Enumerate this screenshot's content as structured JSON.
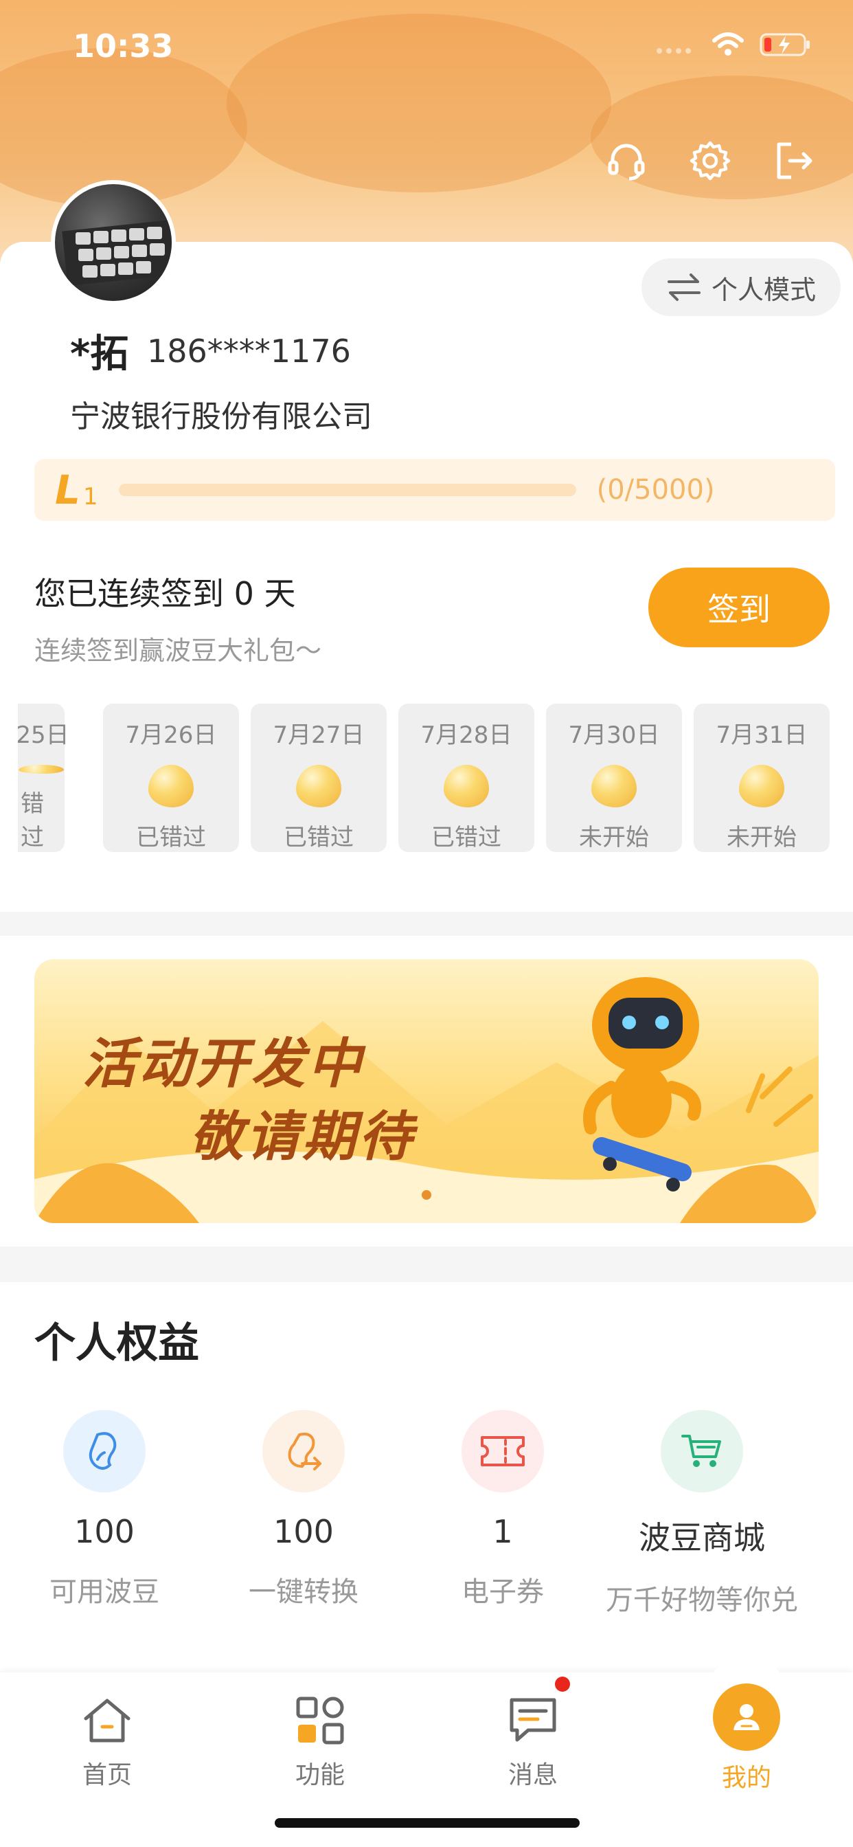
{
  "status_bar": {
    "time": "10:33"
  },
  "header": {
    "icons": [
      "headset-icon",
      "gear-icon",
      "logout-icon"
    ]
  },
  "profile": {
    "mode_label": "个人模式",
    "name": "*拓",
    "phone": "186****1176",
    "company": "宁波银行股份有限公司",
    "level": {
      "letter": "L",
      "number": "1",
      "count": "(0/5000)",
      "progress": 0
    }
  },
  "sign_in": {
    "title": "您已连续签到 0 天",
    "subtitle": "连续签到赢波豆大礼包～",
    "button": "签到",
    "days": [
      {
        "date": "25日",
        "status": "错过"
      },
      {
        "date": "7月26日",
        "status": "已错过"
      },
      {
        "date": "7月27日",
        "status": "已错过"
      },
      {
        "date": "7月28日",
        "status": "已错过"
      },
      {
        "date": "7月30日",
        "status": "未开始"
      },
      {
        "date": "7月31日",
        "status": "未开始"
      }
    ]
  },
  "banner": {
    "line1": "活动开发中",
    "line2": "敬请期待"
  },
  "benefits": {
    "title": "个人权益",
    "items": [
      {
        "value": "100",
        "label": "可用波豆",
        "icon": "bean-icon"
      },
      {
        "value": "100",
        "label": "一键转换",
        "icon": "convert-icon"
      },
      {
        "value": "1",
        "label": "电子券",
        "icon": "ticket-icon"
      },
      {
        "value": "波豆商城",
        "label": "万千好物等你兑",
        "icon": "cart-icon"
      }
    ]
  },
  "tabbar": {
    "items": [
      {
        "label": "首页",
        "icon": "home-icon"
      },
      {
        "label": "功能",
        "icon": "apps-icon"
      },
      {
        "label": "消息",
        "icon": "message-icon"
      },
      {
        "label": "我的",
        "icon": "user-icon"
      }
    ],
    "active_index": 3,
    "accent_color": "#f5a623"
  }
}
